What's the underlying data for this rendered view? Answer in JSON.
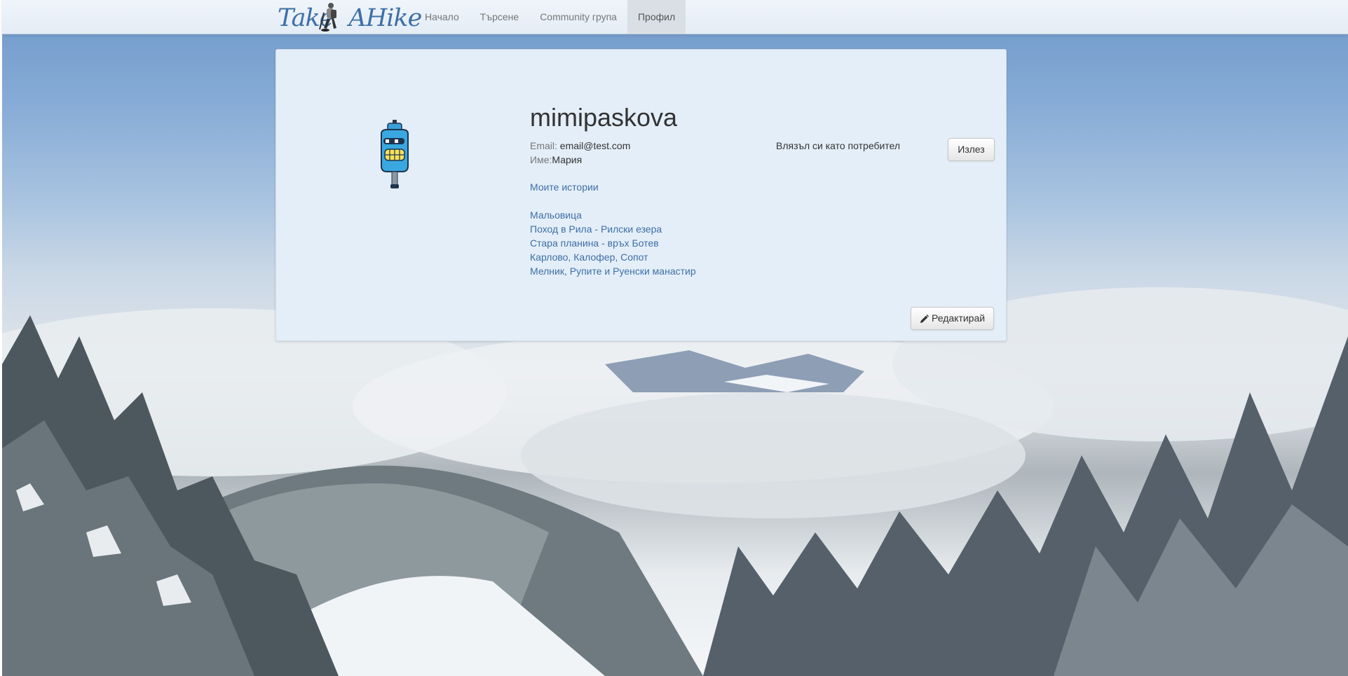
{
  "brand": {
    "name_part1": "Take",
    "name_part2": "AHike"
  },
  "nav": {
    "items": [
      {
        "label": "Начало",
        "active": false
      },
      {
        "label": "Търсене",
        "active": false
      },
      {
        "label": "Community група",
        "active": false
      },
      {
        "label": "Профил",
        "active": true
      }
    ]
  },
  "profile": {
    "username": "mimipaskova",
    "email_label": "Email:",
    "email_value": "email@test.com",
    "name_label": "Име:",
    "name_value": "Мария",
    "stories_title": "Моите истории",
    "stories": [
      "Мальовица",
      "Поход в Рила - Рилски езера",
      "Стара планина - връх Ботев",
      "Карлово, Калофер, Сопот",
      "Мелник, Рупите и Руенски манастир"
    ],
    "logged_in_text": "Влязъл си като потребител",
    "logout_label": "Излез",
    "edit_label": "Редактирай"
  },
  "colors": {
    "link": "#3d6fa6",
    "card_bg": "#e4eef8",
    "navbar_bg": "#e4ecf5",
    "brand": "#3e6fa6"
  },
  "icons": {
    "avatar": "robot-avatar-icon",
    "edit": "pencil-icon",
    "brand": "hiker-logo-icon"
  }
}
